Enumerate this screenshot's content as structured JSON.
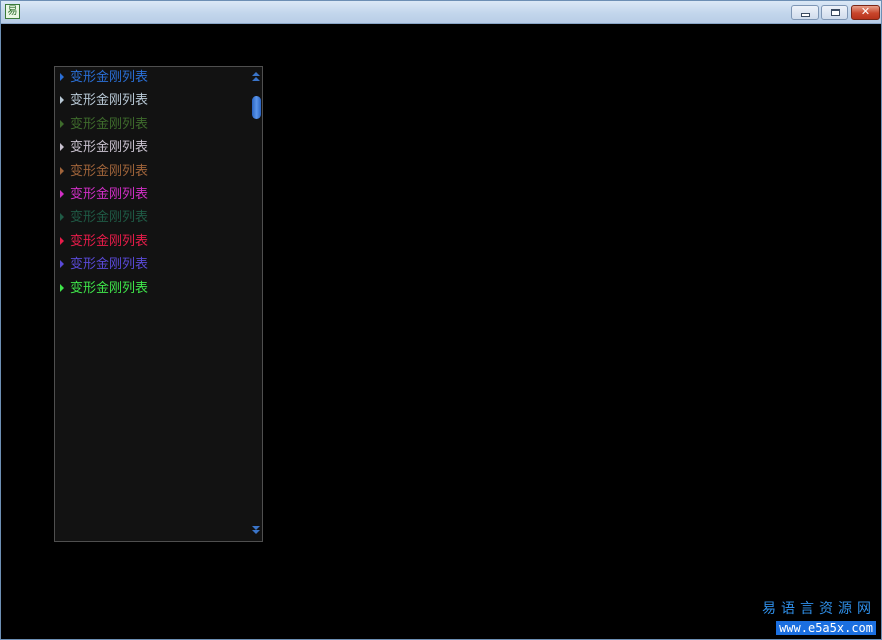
{
  "window": {
    "app_icon_glyph": "易",
    "controls": {
      "minimize_label": "minimize",
      "maximize_label": "maximize",
      "close_glyph": "✕"
    }
  },
  "list": {
    "items": [
      {
        "label": "变形金刚列表",
        "color": "#2a6fd6"
      },
      {
        "label": "变形金刚列表",
        "color": "#b9c9d6"
      },
      {
        "label": "变形金刚列表",
        "color": "#3e6b2c"
      },
      {
        "label": "变形金刚列表",
        "color": "#c9c2cf"
      },
      {
        "label": "变形金刚列表",
        "color": "#a0643a"
      },
      {
        "label": "变形金刚列表",
        "color": "#d12fc6"
      },
      {
        "label": "变形金刚列表",
        "color": "#1f5a45"
      },
      {
        "label": "变形金刚列表",
        "color": "#e81c4a"
      },
      {
        "label": "变形金刚列表",
        "color": "#5a4ad8"
      },
      {
        "label": "变形金刚列表",
        "color": "#3fe64a"
      }
    ],
    "scrollbar": {
      "up_icon": "double-chevron-up-icon",
      "down_icon": "double-chevron-down-icon",
      "thumb_position": 0.05
    }
  },
  "watermark": {
    "line1": "易语言资源网",
    "line2": "www.e5a5x.com"
  }
}
